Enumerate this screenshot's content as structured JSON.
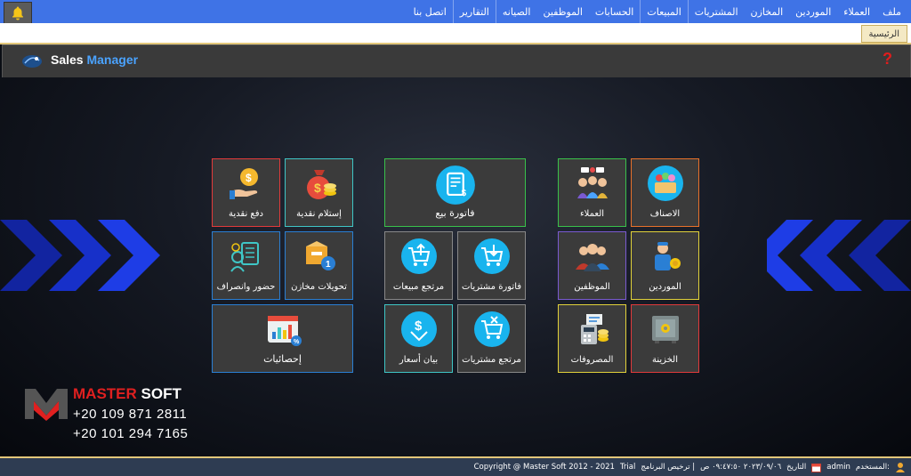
{
  "menu": {
    "items": [
      "ملف",
      "العملاء",
      "الموردين",
      "المخازن",
      "المشتريات",
      "المبيعات",
      "الحسابات",
      "الموظفين",
      "الصيانه",
      "التقارير",
      "اتصل بنا"
    ]
  },
  "tabs": {
    "home": "الرئيسية"
  },
  "header": {
    "title_part1": "Sales",
    "title_part2": "Manager",
    "help": "?"
  },
  "tiles": {
    "items": "الاصناف",
    "customers": "العملاء",
    "sales_invoice": "فاتورة بيع",
    "cash_receipt": "إستلام نقدية",
    "cash_payment": "دفع نقدية",
    "suppliers": "الموردين",
    "employees": "الموظفين",
    "purchase_invoice": "فاتورة مشتريات",
    "sales_return": "مرتجع مبيعات",
    "store_transfers": "تحويلات مخازن",
    "attendance": "حضور وانصراف",
    "treasury": "الخزينة",
    "expenses": "المصروفات",
    "purchase_return": "مرتجع مشتريات",
    "price_quote": "بيان أسعار",
    "statistics": "إحصائيات"
  },
  "brand": {
    "part1": "MASTER",
    "part2": " SOFT",
    "phone1": "+20 109 871 2811",
    "phone2": "+20 101 294 7165"
  },
  "status": {
    "user_label": "المستخدم:",
    "user": "admin",
    "date_label": "التاريخ",
    "datetime": "٢٠٢٣/٠٩/٠٦ ٠٩:٤٧:٥٠ ص",
    "license_label": "ترخيص البرنامج |",
    "license": "Trial",
    "copyright": "Copyright @ Master Soft 2012 - 2021"
  },
  "colors": {
    "menubar": "#3f73e6",
    "icon_circle": "#19b4ee",
    "accent_blue": "#4aa3ff",
    "accent_red": "#e02020",
    "tile_bg": "#3b3b3b"
  }
}
